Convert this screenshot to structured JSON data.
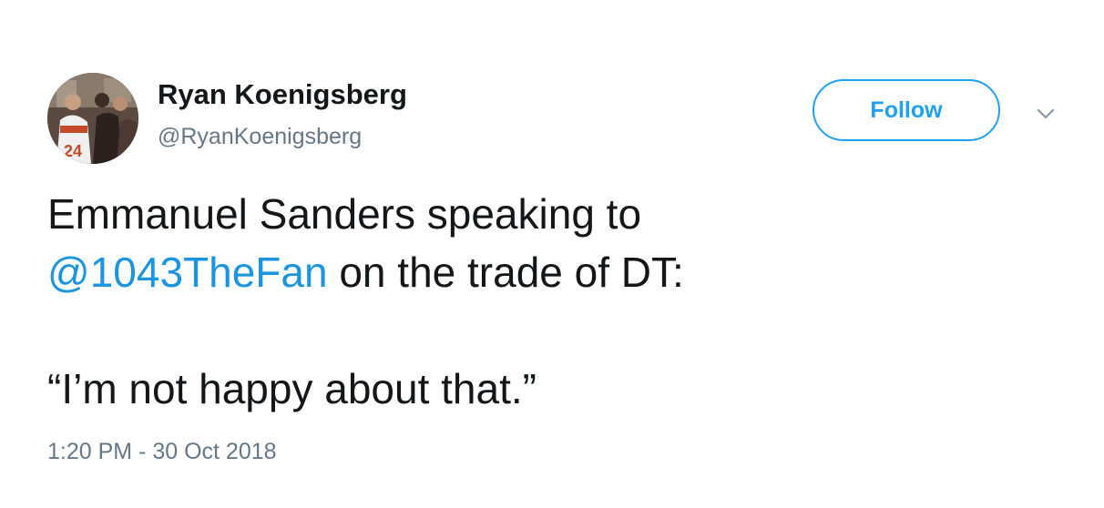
{
  "tweet": {
    "author": {
      "name": "Ryan Koenigsberg",
      "handle": "@RyanKoenigsberg"
    },
    "follow_label": "Follow",
    "menu_icon": "chevron-down-icon",
    "text": {
      "line1": "Emmanuel Sanders speaking to",
      "mention": "@1043TheFan",
      "line2_rest": " on the trade of DT:",
      "quote": "“I’m not happy about that.”"
    },
    "timestamp": "1:20 PM - 30 Oct 2018"
  },
  "colors": {
    "link": "#1b95e0",
    "follow_accent": "#1da1f2",
    "secondary_text": "#657786",
    "primary_text": "#14171a"
  }
}
